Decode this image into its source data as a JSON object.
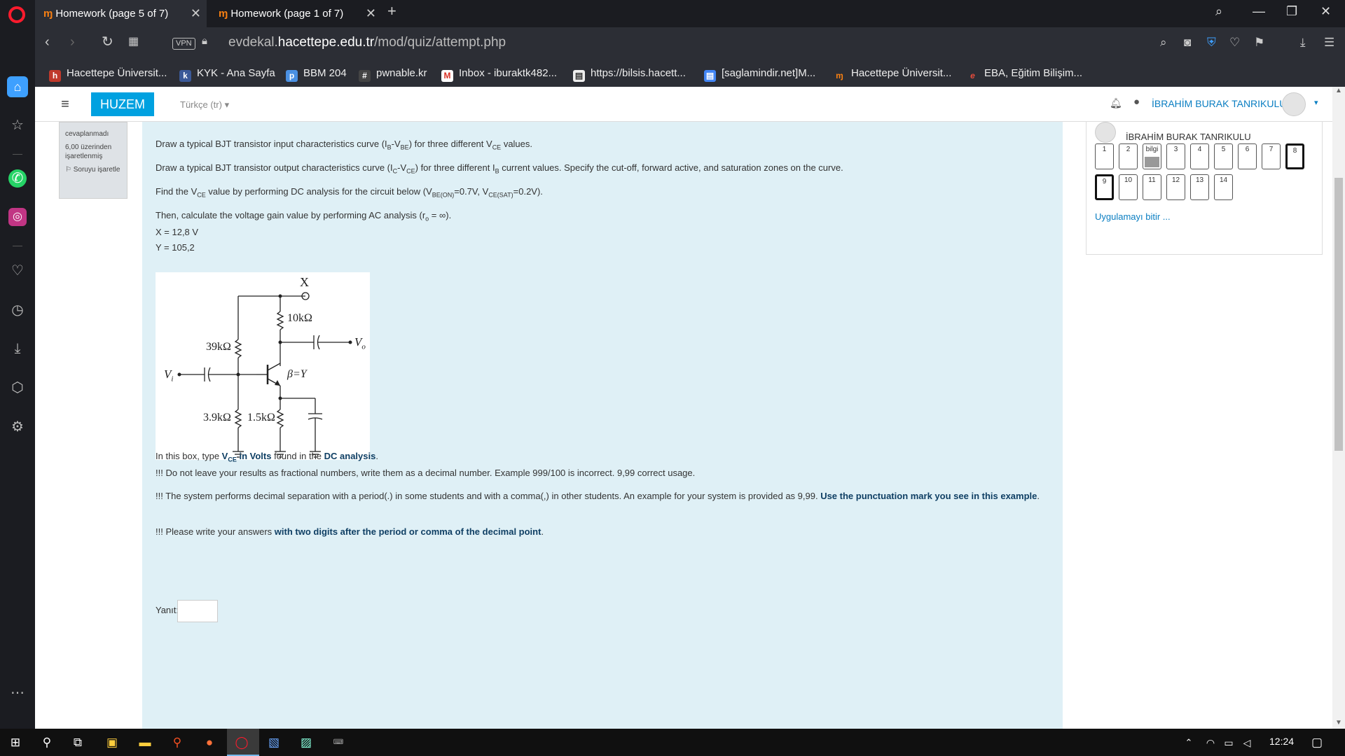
{
  "tabs": [
    {
      "label": "Homework (page 5 of 7)",
      "active": true
    },
    {
      "label": "Homework (page 1 of 7)",
      "active": false
    }
  ],
  "address": {
    "vpn": "VPN",
    "url_prefix": "evdekal.",
    "url_domain": "hacettepe.edu.tr",
    "url_path": "/mod/quiz/attempt.php"
  },
  "bookmarks": [
    "Hacettepe Üniversit...",
    "KYK - Ana Sayfa",
    "BBM 204",
    "pwnable.kr",
    "Inbox - iburaktk482...",
    "https://bilsis.hacett...",
    "[saglamindir.net]M...",
    "Hacettepe Üniversit...",
    "EBA, Eğitim Bilişim..."
  ],
  "header": {
    "brand": "HUZEM",
    "language": "Türkçe (tr)",
    "user": "İBRAHİM BURAK TANRIKULU"
  },
  "question_info": {
    "status": "cevaplanmadı",
    "points": "6,00 üzerinden işaretlenmiş",
    "flag": "Soruyu işaretle"
  },
  "question": {
    "line1_pre": "Draw a typical BJT transistor input characteristics curve (I",
    "line1_sub1": "B",
    "line1_mid": "-V",
    "line1_sub2": "BE",
    "line1_post": ") for three different V",
    "line1_sub3": "CE",
    "line1_end": " values.",
    "line2_pre": "Draw a typical BJT transistor output characteristics curve (I",
    "line2_sub1": "C",
    "line2_mid": "-V",
    "line2_sub2": "CE",
    "line2_post": ") for three different I",
    "line2_sub3": "B",
    "line2_end": " current values. Specify the cut-off, forward active, and saturation zones on the curve.",
    "line3_pre": "Find the V",
    "line3_sub1": "CE",
    "line3_mid": " value by performing DC analysis for the circuit below (V",
    "line3_sub2": "BE(ON)",
    "line3_mid2": "=0.7V, V",
    "line3_sub3": "CE(SAT)",
    "line3_end": "=0.2V).",
    "line4_pre": "Then, calculate the voltage gain value by performing AC analysis (r",
    "line4_sub": "o",
    "line4_end": " = ∞).",
    "x_value": "X = 12,8 V",
    "y_value": "Y = 105,2",
    "inst1_pre": "In this box, type ",
    "inst1_v": "V",
    "inst1_sub": "CE",
    "inst1_mid": " in Volts",
    "inst1_mid2": " found in the ",
    "inst1_dc": "DC analysis",
    "inst1_end": ".",
    "inst2": "!!! Do not leave your results as fractional numbers, write them as a decimal number. Example 999/100 is incorrect. 9,99 correct usage.",
    "inst3_pre": "!!! The system performs decimal separation with a period(.) in some students and with a comma(,) in other students. An example for your system is provided as 9,99. ",
    "inst3_bold": "Use the punctuation mark you see in this example",
    "inst3_end": ".",
    "inst4_pre": "!!! Please write your answers ",
    "inst4_bold": "with two digits after the period or comma of the decimal point",
    "inst4_end": ".",
    "answer_label": "Yanıt:",
    "answer_value": ""
  },
  "circuit": {
    "supply": "X",
    "rc": "10kΩ",
    "r1": "39kΩ",
    "r2": "3.9kΩ",
    "re": "1.5kΩ",
    "beta": "β=Y",
    "vin": "V",
    "vin_sub": "i",
    "vout": "V",
    "vout_sub": "o"
  },
  "quiz_nav": {
    "user": "İBRAHİM BURAK TANRIKULU",
    "buttons": [
      "1",
      "2",
      "bilgi",
      "3",
      "4",
      "5",
      "6",
      "7",
      "8",
      "9",
      "10",
      "11",
      "12",
      "13",
      "14"
    ],
    "finish": "Uygulamayı bitir ..."
  },
  "taskbar": {
    "time": "12:24"
  }
}
